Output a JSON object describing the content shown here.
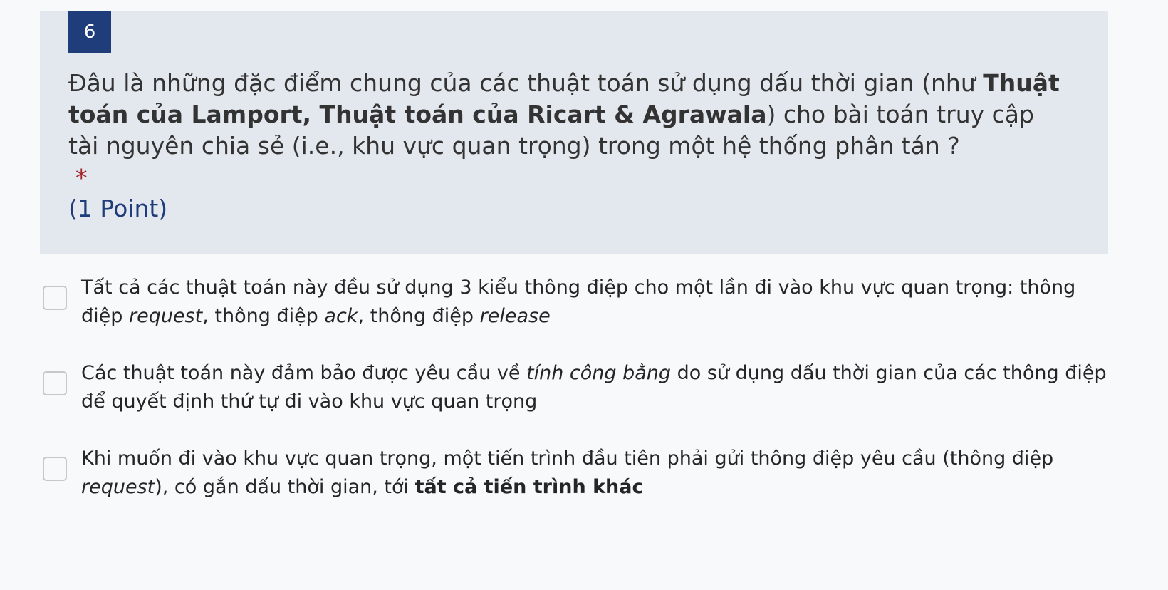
{
  "question": {
    "number": "6",
    "text_part1": "Đâu là những đặc điểm chung của các thuật toán sử dụng dấu thời gian (như ",
    "text_bold": "Thuật toán của Lamport, Thuật toán của Ricart & Agrawala",
    "text_part2": ") cho bài toán truy cập tài nguyên chia sẻ (i.e., khu vực quan trọng) trong một hệ thống phân tán ?",
    "required_mark": "*",
    "points": "(1 Point)"
  },
  "options": [
    {
      "checked": false,
      "p1": "Tất cả các thuật toán này đều sử dụng 3 kiểu thông điệp cho một lần đi vào khu vực quan trọng: thông điệp ",
      "i1": "re­quest",
      "p2": ", thông điệp ",
      "i2": "ack",
      "p3": ", thông điệp ",
      "i3": "release"
    },
    {
      "checked": false,
      "p1": "Các thuật toán này đảm bảo được yêu cầu về ",
      "i1": "tính công bằng",
      "p2": " do sử dụng dấu thời gian của các thông điệp để quyết định thứ tự đi vào khu vực quan trọng"
    },
    {
      "checked": false,
      "p1": "Khi muốn đi vào khu vực quan trọng, một tiến trình đầu tiên phải gửi thông điệp yêu cầu (thông điệp ",
      "i1": "request",
      "p2": "), có gắn dấu thời gian, tới ",
      "b1": "tất cả tiến trình khác"
    }
  ]
}
